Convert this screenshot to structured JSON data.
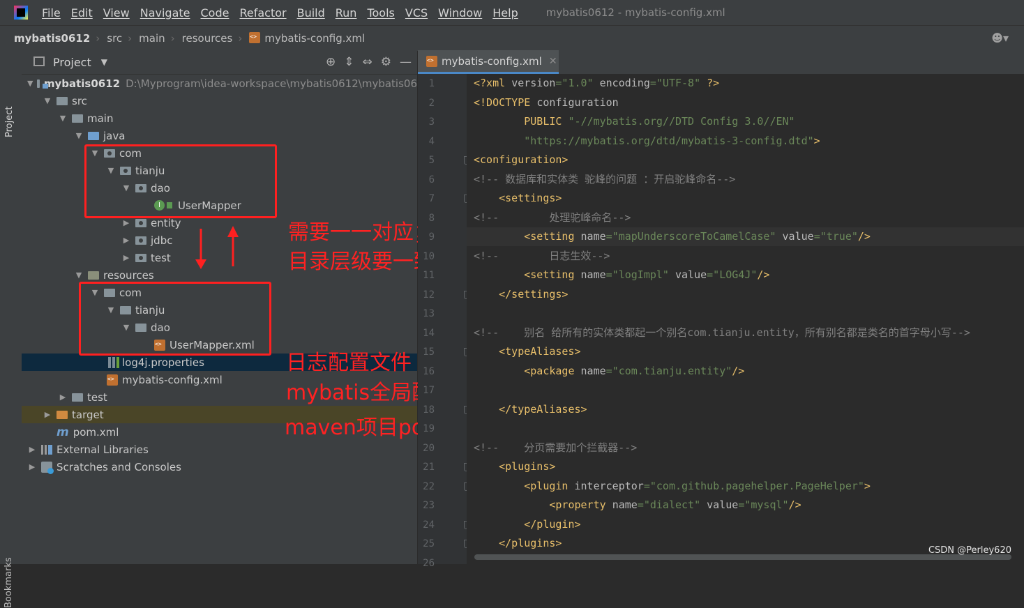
{
  "menubar": {
    "items": [
      "File",
      "Edit",
      "View",
      "Navigate",
      "Code",
      "Refactor",
      "Build",
      "Run",
      "Tools",
      "VCS",
      "Window",
      "Help"
    ],
    "window_title": "mybatis0612 - mybatis-config.xml"
  },
  "breadcrumb": [
    "mybatis0612",
    "src",
    "main",
    "resources",
    "mybatis-config.xml"
  ],
  "project_panel": {
    "title": "Project",
    "tree": [
      {
        "label": "mybatis0612",
        "path": "D:\\Myprogram\\idea-workspace\\mybatis0612\\mybatis06"
      },
      {
        "label": "src"
      },
      {
        "label": "main"
      },
      {
        "label": "java"
      },
      {
        "label": "com"
      },
      {
        "label": "tianju"
      },
      {
        "label": "dao"
      },
      {
        "label": "UserMapper"
      },
      {
        "label": "entity"
      },
      {
        "label": "jdbc"
      },
      {
        "label": "test"
      },
      {
        "label": "resources"
      },
      {
        "label": "com"
      },
      {
        "label": "tianju"
      },
      {
        "label": "dao"
      },
      {
        "label": "UserMapper.xml"
      },
      {
        "label": "log4j.properties"
      },
      {
        "label": "mybatis-config.xml"
      },
      {
        "label": "test"
      },
      {
        "label": "target"
      },
      {
        "label": "pom.xml"
      },
      {
        "label": "External Libraries"
      },
      {
        "label": "Scratches and Consoles"
      }
    ],
    "bookmarks_label": "Bookmarks"
  },
  "annotations": {
    "line1": "需要一一对应；",
    "line2": "目录层级要一致；",
    "log": "日志配置文件",
    "mybatis": "mybatis全局配置文件",
    "maven": "maven项目pom.xml"
  },
  "editor": {
    "tab_label": "mybatis-config.xml",
    "line_numbers": [
      "1",
      "2",
      "3",
      "4",
      "5",
      "6",
      "7",
      "8",
      "9",
      "10",
      "11",
      "12",
      "13",
      "14",
      "15",
      "16",
      "17",
      "18",
      "19",
      "20",
      "21",
      "22",
      "23",
      "24",
      "25",
      "26"
    ],
    "lines": {
      "l1": {
        "p1": "<?xml ",
        "a1": "version",
        "s1": "=\"1.0\" ",
        "a2": "encoding",
        "s2": "=\"UTF-8\"",
        "p2": " ?>"
      },
      "l2": {
        "p1": "<!DOCTYPE ",
        "a1": "configuration"
      },
      "l3": {
        "p1": "        PUBLIC ",
        "s1": "\"-//mybatis.org//DTD Config 3.0//EN\""
      },
      "l4": {
        "s1": "        \"https://mybatis.org/dtd/mybatis-3-config.dtd\"",
        "p1": ">"
      },
      "l5": {
        "t1": "<configuration>"
      },
      "l6": {
        "c1": "<!-- 数据库和实体类 驼峰的问题 ：开启驼峰命名-->"
      },
      "l7": {
        "t1": "    <settings>"
      },
      "l8": {
        "c1": "<!--        处理驼峰命名-->"
      },
      "l9": {
        "t1": "        <setting ",
        "a1": "name",
        "s1": "=\"mapUnderscoreToCamelCase\" ",
        "a2": "value",
        "s2": "=\"true\"",
        "t2": "/>"
      },
      "l10": {
        "c1": "<!--        日志生效-->"
      },
      "l11": {
        "t1": "        <setting ",
        "a1": "name",
        "s1": "=\"logImpl\" ",
        "a2": "value",
        "s2": "=\"LOG4J\"",
        "t2": "/>"
      },
      "l12": {
        "t1": "    </settings>"
      },
      "l14": {
        "c1": "<!--    别名 给所有的实体类都起一个别名com.tianju.entity，所有别名都是类名的首字母小写-->"
      },
      "l15": {
        "t1": "    <typeAliases>"
      },
      "l16": {
        "t1": "        <package ",
        "a1": "name",
        "s1": "=\"com.tianju.entity\"",
        "t2": "/>"
      },
      "l18": {
        "t1": "    </typeAliases>"
      },
      "l20": {
        "c1": "<!--    分页需要加个拦截器-->"
      },
      "l21": {
        "t1": "    <plugins>"
      },
      "l22": {
        "t1": "        <plugin ",
        "a1": "interceptor",
        "s1": "=\"com.github.pagehelper.PageHelper\"",
        "t2": ">"
      },
      "l23": {
        "t1": "            <property ",
        "a1": "name",
        "s1": "=\"dialect\" ",
        "a2": "value",
        "s2": "=\"mysql\"",
        "t2": "/>"
      },
      "l24": {
        "t1": "        </plugin>"
      },
      "l25": {
        "t1": "    </plugins>"
      }
    }
  },
  "watermark": "CSDN @Perley620",
  "colors": {
    "annotation_red": "#ff2222",
    "xml_tag": "#e8bf6a",
    "xml_string": "#6a8759",
    "comment": "#808080"
  }
}
